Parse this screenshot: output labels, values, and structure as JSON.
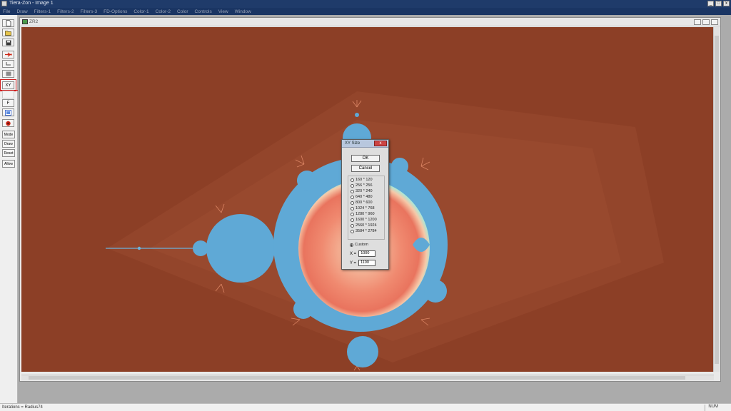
{
  "window": {
    "title": "Tiera-Zon - Image 1",
    "minimize": "_",
    "maximize": "□",
    "close": "x"
  },
  "menu": [
    "File",
    "Draw",
    "Filters-1",
    "Filters-2",
    "Filters-3",
    "FD-Options",
    "Color-1",
    "Color-2",
    "Color",
    "Controls",
    "View",
    "Window"
  ],
  "toolbar": {
    "tools": [
      "new-icon",
      "open-icon",
      "save-icon",
      "forward-icon",
      "back-icon",
      "stop-icon",
      "xy-size",
      "blank",
      "formula",
      "palette-icon",
      "render-icon",
      "Mode",
      "Draw",
      "Reset",
      "Allow"
    ],
    "xy_label": "XY",
    "f_label": "F",
    "mode_label": "Mode",
    "draw_label": "Draw",
    "reset_label": "Reset",
    "allow_label": "Allow"
  },
  "document": {
    "title": "ZR2"
  },
  "colors": {
    "background": "#8c3f26",
    "set_blue": "#5fa9d6",
    "glow_salmon": "#f08a70",
    "glow_light": "#f7d8b8",
    "ring_cyan": "#a8e8d8"
  },
  "dialog": {
    "title": "XY Size",
    "close_label": "x",
    "ok_label": "OK",
    "cancel_label": "Cancel",
    "options": [
      "160 * 120",
      "256 * 256",
      "320 * 240",
      "640 * 480",
      "800 * 600",
      "1024 * 768",
      "1280 * 960",
      "1600 * 1200",
      "2560 * 1924",
      "3584 * 2784"
    ],
    "custom_label": "Custom",
    "x_label": "X =",
    "x_value": "1000",
    "y_label": "Y =",
    "y_value": "1100"
  },
  "status": {
    "text": "Iterations = Radius74",
    "mode": "NUM"
  }
}
